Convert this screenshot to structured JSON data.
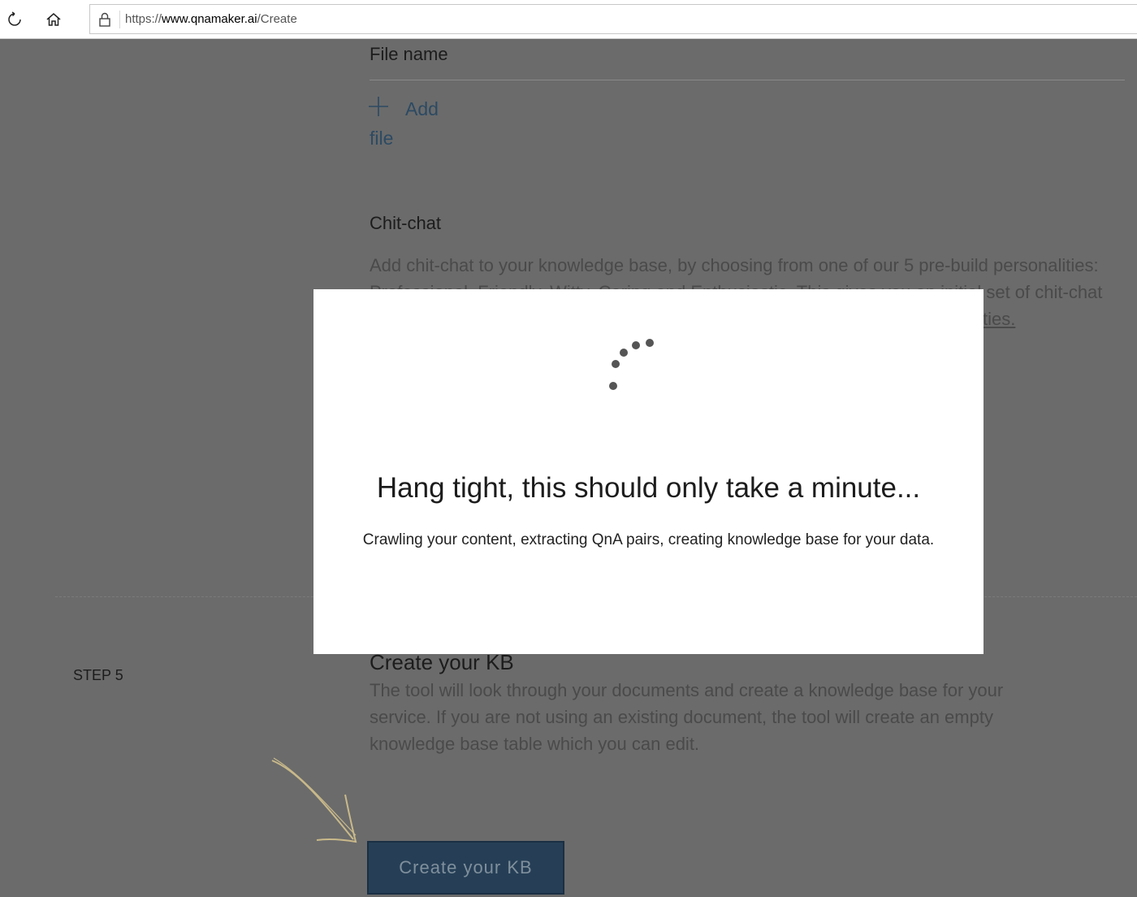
{
  "browser": {
    "url_protocol": "https://",
    "url_host": "www.qnamaker.ai",
    "url_path": "/Create"
  },
  "page": {
    "file_name_header": "File name",
    "add_label": "Add",
    "file_label": "file",
    "chit_chat": {
      "title": "Chit-chat",
      "line1": "Add chit-chat to your knowledge base, by choosing from one of our 5 pre-build personalities:",
      "line2": "Professional, Friendly, Witty, Caring and Enthusiastic. This gives you an initial set of chit-chat",
      "line3_link_tail": "ties."
    },
    "step": {
      "label": "STEP 5",
      "title": "Create your KB",
      "description": "The tool will look through your documents and create a knowledge base for your service. If you are not using an existing document, the tool will create an empty knowledge base table which you can edit."
    },
    "create_button_label": "Create your KB"
  },
  "modal": {
    "title": "Hang tight, this should only take a minute...",
    "subtitle": "Crawling your content, extracting QnA pairs, creating knowledge base for your data."
  },
  "colors": {
    "overlay": "#6b6b6b",
    "link": "#2c4a63",
    "button_bg": "#263f56",
    "arrow": "#c9b98a"
  }
}
